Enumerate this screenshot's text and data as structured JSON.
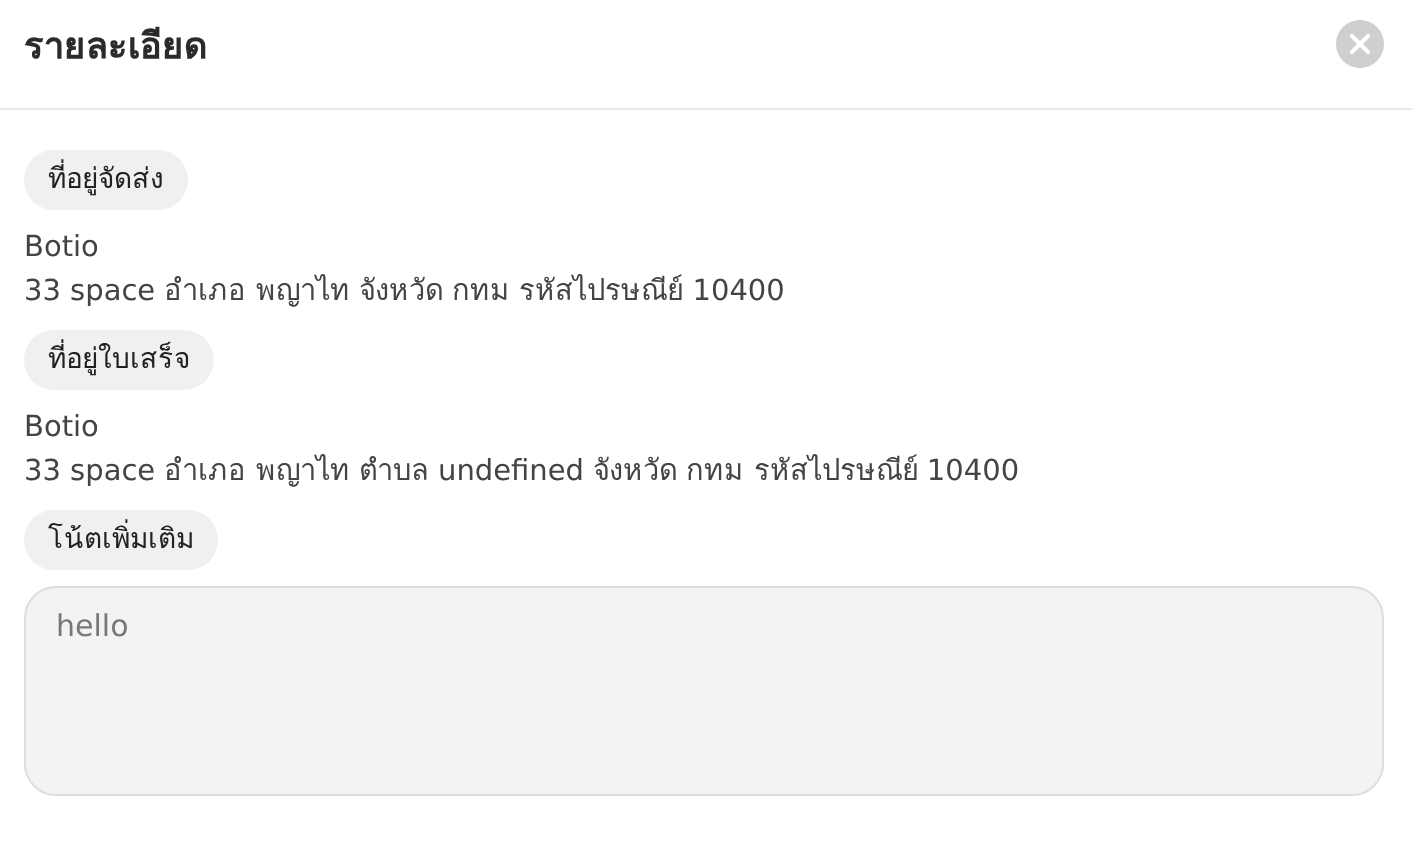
{
  "dialog": {
    "title": "รายละเอียด"
  },
  "sections": [
    {
      "kind": "address",
      "label": "ที่อยู่จัดส่ง",
      "name": "Botio",
      "address": "33 space อำเภอ พญาไท จังหวัด กทม รหัสไปรษณีย์ 10400"
    },
    {
      "kind": "address",
      "label": "ที่อยู่ใบเสร็จ",
      "name": "Botio",
      "address": "33 space อำเภอ พญาไท ตำบล undefined จังหวัด กทม รหัสไปรษณีย์ 10400"
    },
    {
      "kind": "note",
      "label": "โน้ตเพิ่มเติม",
      "value": "hello"
    }
  ]
}
